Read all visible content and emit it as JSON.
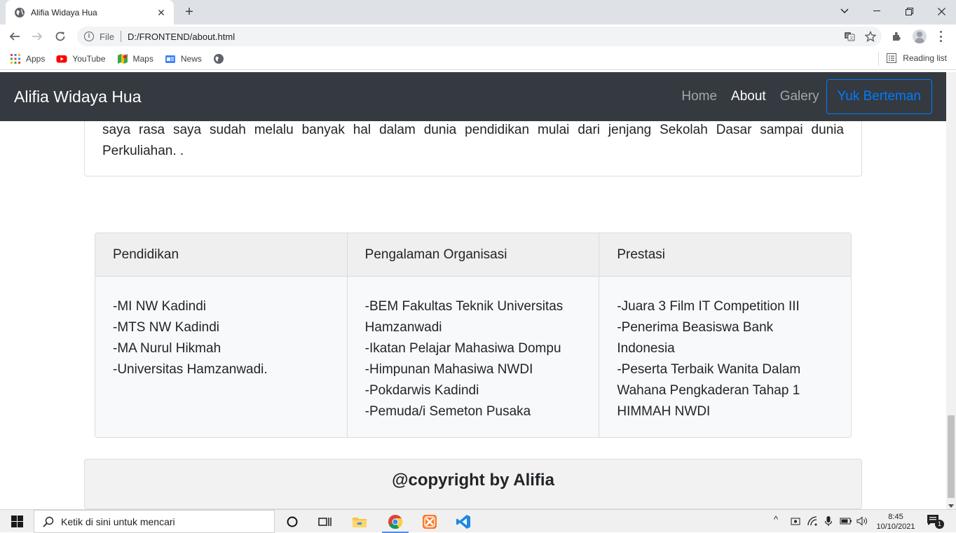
{
  "browser": {
    "tab_title": "Alifia Widaya Hua",
    "new_tab": "+",
    "scheme": "File",
    "url": "D:/FRONTEND/about.html",
    "bookmarks": [
      {
        "label": "Apps",
        "icon": "apps-grid-icon"
      },
      {
        "label": "YouTube",
        "icon": "youtube-icon"
      },
      {
        "label": "Maps",
        "icon": "maps-icon"
      },
      {
        "label": "News",
        "icon": "news-icon"
      }
    ],
    "reading_list": "Reading list"
  },
  "navbar": {
    "brand": "Alifia Widaya Hua",
    "links": [
      "Home",
      "About",
      "Galery"
    ],
    "cta": "Yuk Berteman"
  },
  "intro": {
    "text": "saya rasa saya sudah melalu banyak hal dalam dunia pendidikan mulai dari jenjang Sekolah Dasar sampai dunia Perkuliahan. ."
  },
  "columns": [
    {
      "title": "Pendidikan",
      "items": [
        "-MI NW Kadindi",
        "-MTS NW Kadindi",
        "-MA Nurul Hikmah",
        "-Universitas Hamzanwadi."
      ]
    },
    {
      "title": "Pengalaman Organisasi",
      "items": [
        "-BEM Fakultas Teknik Universitas Hamzanwadi",
        "-Ikatan Pelajar Mahasiwa Dompu",
        "-Himpunan Mahasiwa NWDI",
        "-Pokdarwis Kadindi",
        "-Pemuda/i Semeton Pusaka"
      ]
    },
    {
      "title": "Prestasi",
      "items": [
        "-Juara 3 Film IT Competition III",
        "-Penerima Beasiswa Bank Indonesia",
        "-Peserta Terbaik Wanita Dalam Wahana Pengkaderan Tahap 1 HIMMAH NWDI"
      ]
    }
  ],
  "footer": {
    "text": "@copyright by Alifia"
  },
  "taskbar": {
    "search_placeholder": "Ketik di sini untuk mencari",
    "time": "8:45",
    "date": "10/10/2021",
    "notifications": "1"
  },
  "colors": {
    "navbar_bg": "#343a40",
    "accent": "#007bff"
  }
}
